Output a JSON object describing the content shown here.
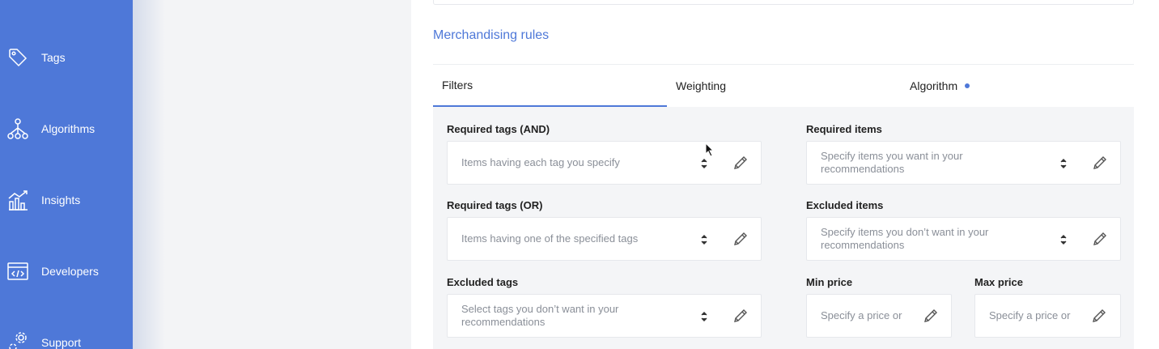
{
  "sidebar": {
    "items": [
      {
        "label": "Tags",
        "icon": "tag-icon"
      },
      {
        "label": "Algorithms",
        "icon": "algorithm-tree-icon"
      },
      {
        "label": "Insights",
        "icon": "chart-icon"
      },
      {
        "label": "Developers",
        "icon": "code-window-icon"
      },
      {
        "label": "Support",
        "icon": "gears-icon"
      }
    ]
  },
  "section": {
    "title": "Merchandising rules"
  },
  "tabs": [
    {
      "label": "Filters",
      "active": true
    },
    {
      "label": "Weighting",
      "active": false
    },
    {
      "label": "Algorithm",
      "active": false,
      "has_indicator": true
    }
  ],
  "filters": {
    "required_tags_and": {
      "label": "Required tags (AND)",
      "placeholder": "Items having each tag you specify"
    },
    "required_items": {
      "label": "Required items",
      "placeholder": "Specify items you want in your recommendations"
    },
    "required_tags_or": {
      "label": "Required tags (OR)",
      "placeholder": "Items having one of the specified tags"
    },
    "excluded_items": {
      "label": "Excluded items",
      "placeholder": "Specify items you don’t want in your recommendations"
    },
    "excluded_tags": {
      "label": "Excluded tags",
      "placeholder": "Select tags you don’t want in your recommendations"
    },
    "min_price": {
      "label": "Min price",
      "placeholder": "Specify a price or"
    },
    "max_price": {
      "label": "Max price",
      "placeholder": "Specify a price or"
    }
  },
  "colors": {
    "accent": "#4e78d8",
    "sidebar_bg": "#4e78d8",
    "panel_bg": "#f4f5f7"
  }
}
